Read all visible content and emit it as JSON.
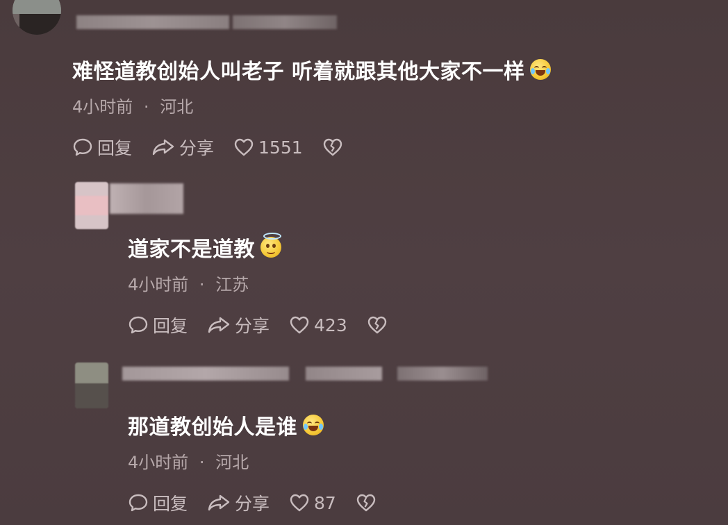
{
  "comments": [
    {
      "text": "难怪道教创始人叫老子 听着就跟其他大家不一样",
      "emoji": "laugh-cry-emoji",
      "time": "4小时前",
      "separator": "·",
      "location": "河北",
      "reply_label": "回复",
      "share_label": "分享",
      "likes": "1551"
    },
    {
      "text": "道家不是道教",
      "emoji": "halo-smile-emoji",
      "time": "4小时前",
      "separator": "·",
      "location": "江苏",
      "reply_label": "回复",
      "share_label": "分享",
      "likes": "423"
    },
    {
      "text": "那道教创始人是谁",
      "emoji": "laugh-cry-emoji",
      "time": "4小时前",
      "separator": "·",
      "location": "河北",
      "reply_label": "回复",
      "share_label": "分享",
      "likes": "87"
    }
  ],
  "colors": {
    "background": "#4b3c3f",
    "text": "#ffffff",
    "meta": "#b7a9ab",
    "actions": "#c9bdbf"
  }
}
